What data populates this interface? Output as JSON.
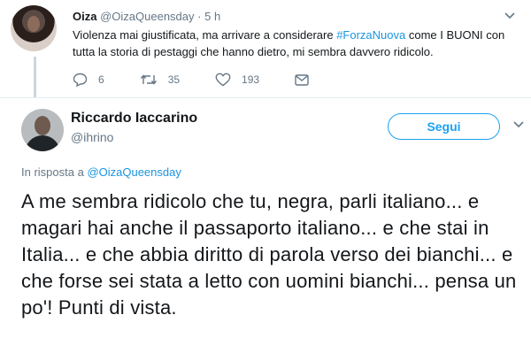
{
  "reply_tweet": {
    "author_name": "Oiza",
    "author_handle": "@OizaQueensday",
    "separator": "·",
    "time": "5 h",
    "text_before": "Violenza mai giustificata, ma arrivare a considerare ",
    "hashtag": "#ForzaNuova",
    "text_after": " come I BUONI con tutta la storia di pestaggi che hanno dietro, mi sembra davvero ridicolo.",
    "replies": "6",
    "retweets": "35",
    "likes": "193"
  },
  "main_tweet": {
    "author_name": "Riccardo Iaccarino",
    "author_handle": "@ihrino",
    "follow_label": "Segui",
    "reply_prefix": "In risposta a ",
    "reply_mention": "@OizaQueensday",
    "text": "A me sembra ridicolo che tu, negra, parli italiano... e magari hai anche il passaporto italiano... e che stai in Italia... e che abbia diritto di parola verso dei bianchi... e che forse sei stata a letto con uomini bianchi... pensa un po'! Punti di vista."
  },
  "icons": {
    "reply": "reply-icon",
    "retweet": "retweet-icon",
    "like": "heart-icon",
    "dm": "envelope-icon",
    "more": "chevron-down-icon"
  },
  "colors": {
    "accent": "#1da1f2",
    "link": "#1b95e0",
    "muted": "#657786",
    "text": "#14171a"
  }
}
